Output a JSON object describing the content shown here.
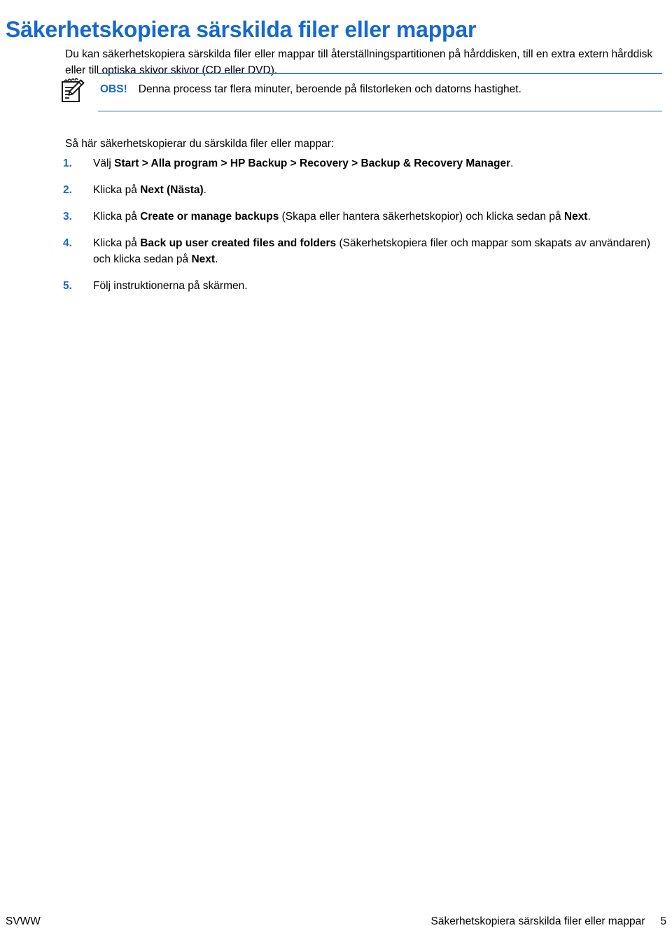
{
  "document": {
    "title": "Säkerhetskopiera särskilda filer eller mappar",
    "title_color": "#1669cd",
    "intro": "Du kan säkerhetskopiera särskilda filer eller mappar till återställningspartitionen på hårddisken, till en extra extern hårddisk eller till optiska skivor skivor (CD eller DVD)."
  },
  "note": {
    "icon": "notepad-pencil-icon",
    "label": "OBS!",
    "label_color": "#1669cd",
    "text": "Denna process tar flera minuter, beroende på filstorleken och datorns hastighet.",
    "border_top_color": "#4a86c8",
    "border_bottom_color": "#a7c4e2"
  },
  "leadin": "Så här säkerhetskopierar du särskilda filer eller mappar:",
  "steps": [
    {
      "number": "1.",
      "parts": [
        {
          "text": "Välj ",
          "bold": false
        },
        {
          "text": "Start > Alla program > HP Backup > Recovery > Backup & Recovery Manager",
          "bold": true
        },
        {
          "text": ".",
          "bold": false
        }
      ]
    },
    {
      "number": "2.",
      "parts": [
        {
          "text": "Klicka på ",
          "bold": false
        },
        {
          "text": "Next (Nästa)",
          "bold": true
        },
        {
          "text": ".",
          "bold": false
        }
      ]
    },
    {
      "number": "3.",
      "parts": [
        {
          "text": "Klicka på ",
          "bold": false
        },
        {
          "text": "Create or manage backups",
          "bold": true
        },
        {
          "text": " (Skapa eller hantera säkerhetskopior) och klicka sedan på ",
          "bold": false
        },
        {
          "text": "Next",
          "bold": true
        },
        {
          "text": ".",
          "bold": false
        }
      ]
    },
    {
      "number": "4.",
      "parts": [
        {
          "text": "Klicka på ",
          "bold": false
        },
        {
          "text": "Back up user created files and folders",
          "bold": true
        },
        {
          "text": " (Säkerhetskopiera filer och mappar som skapats av användaren) och klicka sedan på ",
          "bold": false
        },
        {
          "text": "Next",
          "bold": true
        },
        {
          "text": ".",
          "bold": false
        }
      ]
    },
    {
      "number": "5.",
      "parts": [
        {
          "text": "Följ instruktionerna på skärmen.",
          "bold": false
        }
      ]
    }
  ],
  "footer": {
    "left": "SVWW",
    "chapter": "Säkerhetskopiera särskilda filer eller mappar",
    "page": "5"
  }
}
